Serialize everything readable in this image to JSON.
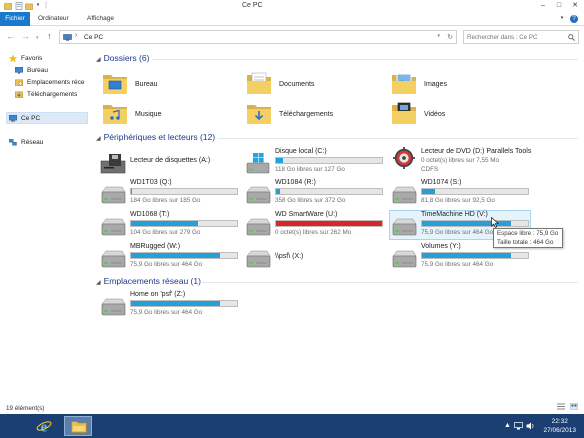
{
  "window": {
    "title": "Ce PC"
  },
  "ribbon": {
    "tabs": [
      "Fichier",
      "Ordinateur",
      "Affichage"
    ]
  },
  "address": {
    "path_root": "Ce PC",
    "search_placeholder": "Rechercher dans : Ce PC"
  },
  "navpane": {
    "favoris": "Favoris",
    "bureau": "Bureau",
    "emplacements": "Emplacements réce",
    "telechargements": "Téléchargements",
    "cepc": "Ce PC",
    "reseau": "Réseau"
  },
  "groups": {
    "dossiers": "Dossiers (6)",
    "peripheriques": "Périphériques et lecteurs (12)",
    "reseau": "Emplacements réseau (1)"
  },
  "folders": [
    {
      "label": "Bureau",
      "icon": "desktop-folder"
    },
    {
      "label": "Documents",
      "icon": "documents-folder"
    },
    {
      "label": "Images",
      "icon": "pictures-folder"
    },
    {
      "label": "Musique",
      "icon": "music-folder"
    },
    {
      "label": "Téléchargements",
      "icon": "downloads-folder"
    },
    {
      "label": "Vidéos",
      "icon": "videos-folder"
    }
  ],
  "drives": {
    "floppy": {
      "name": "Lecteur de disquettes (A:)"
    },
    "c": {
      "name": "Disque local (C:)",
      "info": "118 Go libres sur 127 Go",
      "used_fraction": 0.07
    },
    "dvd": {
      "name": "Lecteur de DVD (D:) Parallels Tools",
      "info": "0 octet(s) libres sur 7,55 Mo",
      "fs": "CDFS",
      "used_fraction": 1.0
    },
    "q": {
      "name": "WD1T03 (Q:)",
      "info": "184 Go libres sur 185 Go",
      "used_fraction": 0.01
    },
    "r": {
      "name": "WD1084 (R:)",
      "info": "358 Go libres sur 372 Go",
      "used_fraction": 0.04
    },
    "s": {
      "name": "WD1074 (S:)",
      "info": "81,8 Go libres sur 92,5 Go",
      "used_fraction": 0.12
    },
    "t": {
      "name": "WD1068 (T:)",
      "info": "104 Go libres sur 279 Go",
      "used_fraction": 0.63
    },
    "u": {
      "name": "WD SmartWare (U:)",
      "info": "0 octet(s) libres sur 262 Mo",
      "used_fraction": 1.0
    },
    "v": {
      "name": "TimeMachine HD (V:)",
      "info": "75,9 Go libres sur 464 Go",
      "used_fraction": 0.84
    },
    "w": {
      "name": "MBRugged (W:)",
      "info": "75,9 Go libres sur 464 Go",
      "used_fraction": 0.84
    },
    "x": {
      "name": "\\\\psf\\ (X:)",
      "info": "",
      "used_fraction": 0.0
    },
    "y": {
      "name": "Volumes (Y:)",
      "info": "75,9 Go libres sur 464 Go",
      "used_fraction": 0.84
    },
    "z": {
      "name": "Home on 'psf' (Z:)",
      "info": "75,9 Go libres sur 464 Go",
      "used_fraction": 0.84
    }
  },
  "tooltip": {
    "line1": "Espace libre : 75,9 Go",
    "line2": "Taille totale : 464 Go"
  },
  "status": {
    "count": "19 élément(s)"
  },
  "taskbar": {
    "time": "22:32",
    "date": "27/06/2013"
  },
  "colors": {
    "accent": "#1979ca",
    "bar_fill": "#26a0da",
    "bar_full": "#da2626",
    "taskbar": "#1c3f73",
    "group_head": "#1e3a8a"
  }
}
